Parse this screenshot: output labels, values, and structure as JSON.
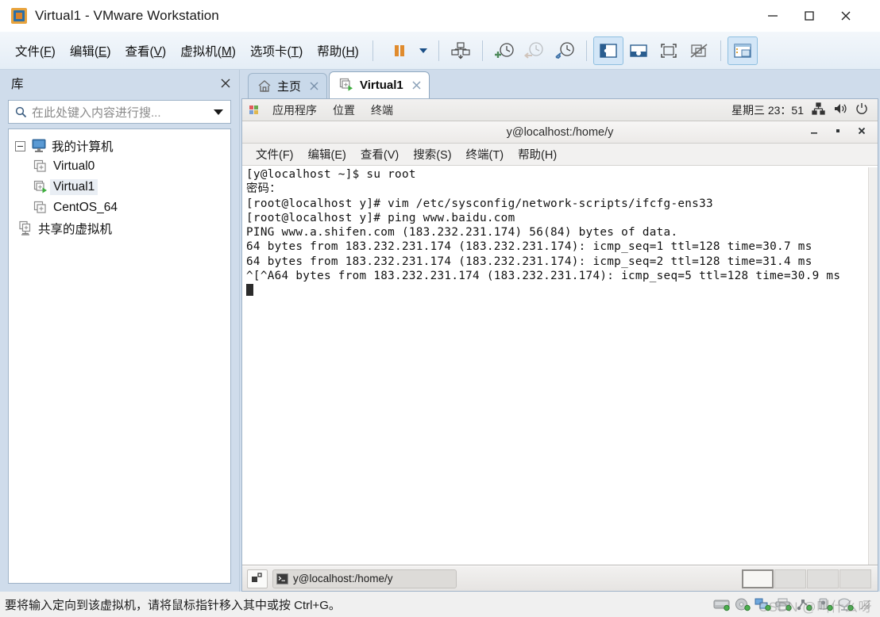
{
  "window": {
    "title": "Virtual1 - VMware Workstation",
    "app_icon": "vmware-icon",
    "minimize": "minimize-icon",
    "maximize": "maximize-icon",
    "close": "close-icon"
  },
  "menubar": {
    "items": [
      {
        "text": "文件(",
        "key": "F",
        "tail": ")"
      },
      {
        "text": "编辑(",
        "key": "E",
        "tail": ")"
      },
      {
        "text": "查看(",
        "key": "V",
        "tail": ")"
      },
      {
        "text": "虚拟机(",
        "key": "M",
        "tail": ")"
      },
      {
        "text": "选项卡(",
        "key": "T",
        "tail": ")"
      },
      {
        "text": "帮助(",
        "key": "H",
        "tail": ")"
      }
    ]
  },
  "toolbar": {
    "buttons": [
      {
        "name": "suspend-button",
        "label": "挂起"
      },
      {
        "name": "power-dropdown-caret",
        "label": "电源下拉"
      },
      {
        "name": "manage-snapshot-button",
        "label": "管理快照"
      },
      {
        "name": "take-snapshot-button",
        "label": "拍摄快照"
      },
      {
        "name": "revert-snapshot-button",
        "label": "恢复快照"
      },
      {
        "name": "snapshot-manager-button",
        "label": "快照管理器"
      },
      {
        "name": "show-library-button",
        "label": "显示库"
      },
      {
        "name": "show-thumbnail-bar-button",
        "label": "显示缩略图栏"
      },
      {
        "name": "fullscreen-button",
        "label": "全屏"
      },
      {
        "name": "unity-button",
        "label": "Unity 模式"
      },
      {
        "name": "console-view-button",
        "label": "控制台视图"
      }
    ]
  },
  "sidebar": {
    "title": "库",
    "close_label": "关闭库",
    "search_placeholder": "在此处键入内容进行搜...",
    "search_value": "",
    "tree": [
      {
        "label": "我的计算机",
        "icon": "computer-icon",
        "level": 0,
        "expanded": true,
        "selected": false
      },
      {
        "label": "Virtual0",
        "icon": "vm-icon",
        "level": 1,
        "selected": false,
        "running": false
      },
      {
        "label": "Virtual1",
        "icon": "vm-running-icon",
        "level": 1,
        "selected": true,
        "running": true
      },
      {
        "label": "CentOS_64",
        "icon": "vm-icon",
        "level": 1,
        "selected": false,
        "running": false
      },
      {
        "label": "共享的虚拟机",
        "icon": "shared-vm-icon",
        "level": 0,
        "selected": false,
        "running": false
      }
    ]
  },
  "tabs": [
    {
      "label": "主页",
      "icon": "home-icon",
      "active": false,
      "close": "close-icon"
    },
    {
      "label": "Virtual1",
      "icon": "vm-running-icon",
      "active": true,
      "close": "close-icon"
    }
  ],
  "guest": {
    "panel": {
      "logo": "gnome-foot-icon",
      "menus": [
        "应用程序",
        "位置",
        "终端"
      ],
      "clock": "星期三 23：51",
      "tray": [
        "network-icon",
        "volume-icon",
        "power-icon"
      ]
    },
    "terminal_window": {
      "title": "y@localhost:/home/y",
      "minimize": "minimize-icon",
      "maximize": "maximize-icon",
      "close": "close-icon",
      "menus": [
        "文件(F)",
        "编辑(E)",
        "查看(V)",
        "搜索(S)",
        "终端(T)",
        "帮助(H)"
      ],
      "lines": [
        "[y@localhost ~]$ su root",
        "密码：",
        "[root@localhost y]# vim /etc/sysconfig/network-scripts/ifcfg-ens33",
        "[root@localhost y]# ping www.baidu.com",
        "PING www.a.shifen.com (183.232.231.174) 56(84) bytes of data.",
        "64 bytes from 183.232.231.174 (183.232.231.174): icmp_seq=1 ttl=128 time=30.7 ms",
        "64 bytes from 183.232.231.174 (183.232.231.174): icmp_seq=2 ttl=128 time=31.4 ms",
        "^[^A64 bytes from 183.232.231.174 (183.232.231.174): icmp_seq=5 ttl=128 time=30.9 ms"
      ]
    },
    "taskbar": {
      "show_desktop": "show-desktop-icon",
      "task_label": "y@localhost:/home/y",
      "task_icon": "terminal-icon",
      "workspaces": [
        {
          "active": true
        },
        {
          "active": false
        },
        {
          "active": false
        },
        {
          "active": false
        }
      ]
    }
  },
  "statusbar": {
    "message": "要将输入定向到该虚拟机，请将鼠标指针移入其中或按 Ctrl+G。",
    "devices": [
      {
        "name": "harddisk-icon"
      },
      {
        "name": "cdrom-icon"
      },
      {
        "name": "network-icon"
      },
      {
        "name": "printer-icon"
      },
      {
        "name": "usb-icon"
      },
      {
        "name": "sound-icon"
      },
      {
        "name": "display-icon"
      }
    ],
    "watermark": "CSDN @叫什么呀"
  },
  "colors": {
    "accent": "#2a6fa8",
    "toolbar_top": "#f3f7fb",
    "toolbar_bottom": "#e4edf6",
    "sidebar_bg": "#cfdceb",
    "active_tab": "#ffffff",
    "terminal_fg": "#111111",
    "terminal_bg": "#ffffff",
    "suspend_orange": "#e08b2d"
  }
}
